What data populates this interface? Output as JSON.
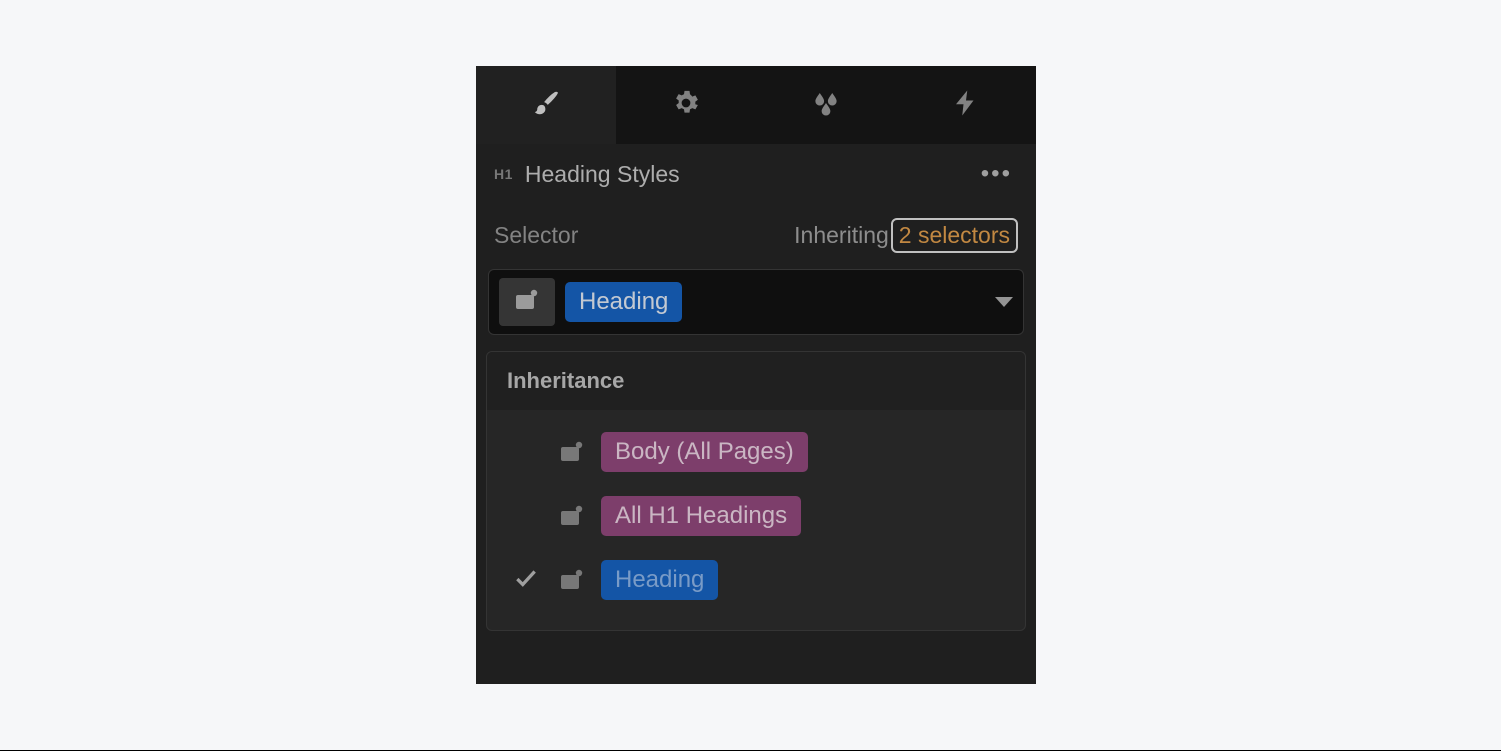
{
  "tabs": [
    {
      "name": "style-tab",
      "icon": "brush-icon",
      "active": true
    },
    {
      "name": "settings-tab",
      "icon": "gear-icon",
      "active": false
    },
    {
      "name": "effects-tab",
      "icon": "droplets-icon",
      "active": false
    },
    {
      "name": "actions-tab",
      "icon": "bolt-icon",
      "active": false
    }
  ],
  "header": {
    "element_badge": "H1",
    "title": "Heading Styles"
  },
  "selector": {
    "label": "Selector",
    "inheriting_label": "Inheriting",
    "inheriting_count_text": "2 selectors",
    "current_class": "Heading"
  },
  "inheritance": {
    "title": "Inheritance",
    "items": [
      {
        "label": "Body (All Pages)",
        "kind": "global",
        "checked": false
      },
      {
        "label": "All H1 Headings",
        "kind": "global",
        "checked": false
      },
      {
        "label": "Heading",
        "kind": "class",
        "checked": true
      }
    ]
  },
  "colors": {
    "accent_orange": "#e8a24c",
    "chip_blue": "#1463c6",
    "chip_purple": "#94477e"
  }
}
